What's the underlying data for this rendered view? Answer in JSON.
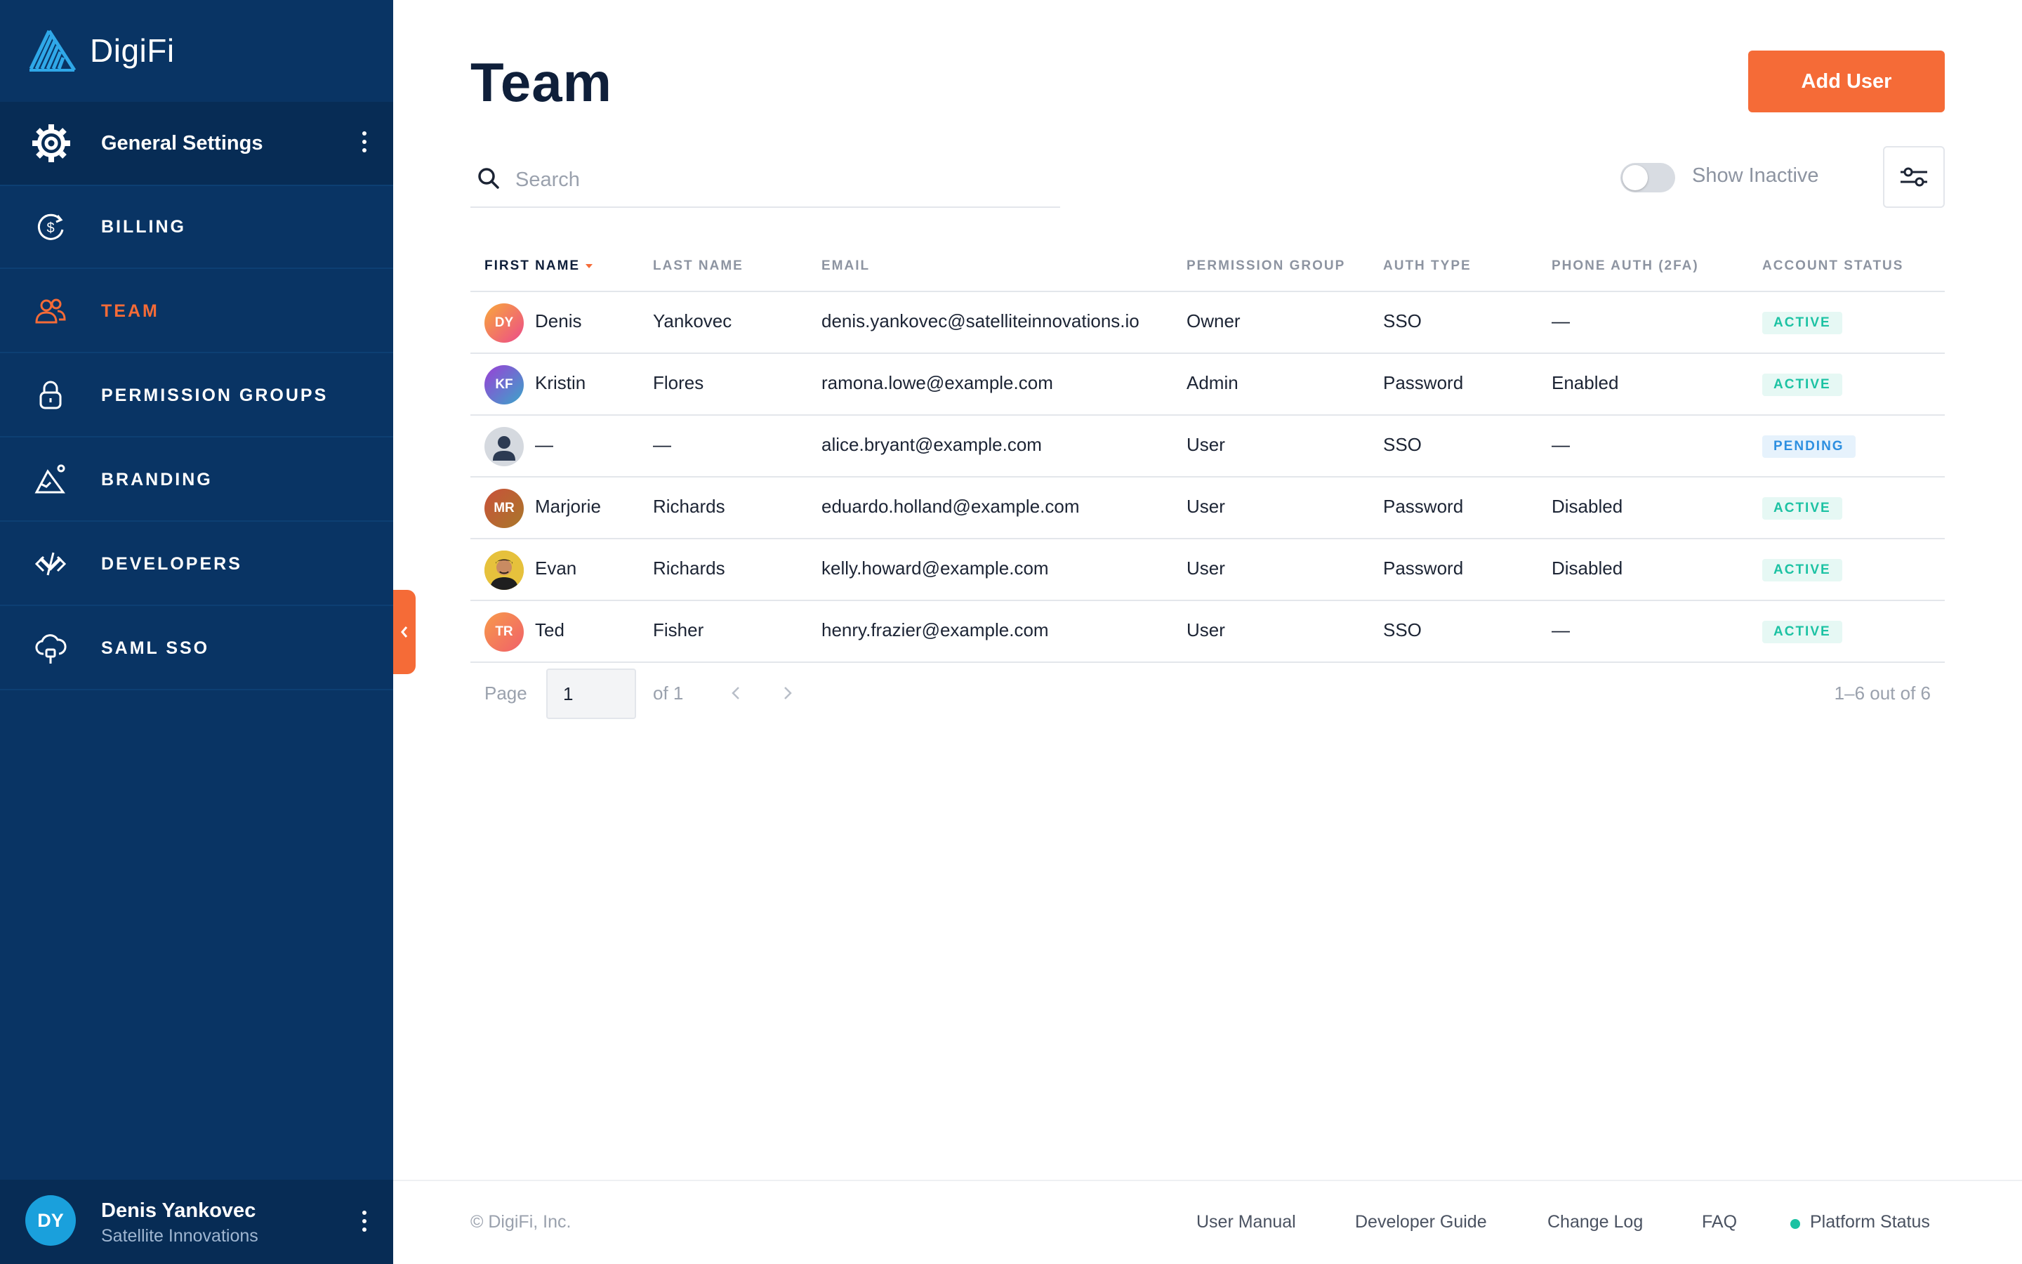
{
  "brand": {
    "name": "DigiFi"
  },
  "sidebar": {
    "settings_label": "General Settings",
    "items": [
      {
        "label": "BILLING",
        "icon": "billing-icon"
      },
      {
        "label": "TEAM",
        "icon": "team-icon"
      },
      {
        "label": "PERMISSION GROUPS",
        "icon": "lock-icon"
      },
      {
        "label": "BRANDING",
        "icon": "branding-icon"
      },
      {
        "label": "DEVELOPERS",
        "icon": "code-icon"
      },
      {
        "label": "SAML SSO",
        "icon": "cloud-lock-icon"
      }
    ],
    "active_item": "TEAM",
    "user": {
      "initials": "DY",
      "name": "Denis Yankovec",
      "org": "Satellite Innovations"
    }
  },
  "page": {
    "title": "Team",
    "add_button": "Add User",
    "search_placeholder": "Search",
    "show_inactive_label": "Show Inactive",
    "show_inactive_on": false
  },
  "table": {
    "columns": [
      "FIRST NAME",
      "LAST NAME",
      "EMAIL",
      "PERMISSION GROUP",
      "AUTH TYPE",
      "PHONE AUTH (2FA)",
      "ACCOUNT STATUS"
    ],
    "sorted_by": "FIRST NAME",
    "rows": [
      {
        "initials": "DY",
        "first": "Denis",
        "last": "Yankovec",
        "email": "denis.yankovec@satelliteinnovations.io",
        "group": "Owner",
        "auth": "SSO",
        "phone": "—",
        "status": "ACTIVE"
      },
      {
        "initials": "KF",
        "first": "Kristin",
        "last": "Flores",
        "email": "ramona.lowe@example.com",
        "group": "Admin",
        "auth": "Password",
        "phone": "Enabled",
        "status": "ACTIVE"
      },
      {
        "initials": "",
        "first": "—",
        "last": "—",
        "email": "alice.bryant@example.com",
        "group": "User",
        "auth": "SSO",
        "phone": "—",
        "status": "PENDING"
      },
      {
        "initials": "MR",
        "first": "Marjorie",
        "last": "Richards",
        "email": "eduardo.holland@example.com",
        "group": "User",
        "auth": "Password",
        "phone": "Disabled",
        "status": "ACTIVE"
      },
      {
        "initials": "",
        "first": "Evan",
        "last": "Richards",
        "email": "kelly.howard@example.com",
        "group": "User",
        "auth": "Password",
        "phone": "Disabled",
        "status": "ACTIVE"
      },
      {
        "initials": "TR",
        "first": "Ted",
        "last": "Fisher",
        "email": "henry.frazier@example.com",
        "group": "User",
        "auth": "SSO",
        "phone": "—",
        "status": "ACTIVE"
      }
    ]
  },
  "pagination": {
    "page_label": "Page",
    "page": "1",
    "of_label": "of 1",
    "summary": "1–6 out of 6"
  },
  "footer": {
    "copyright": "© DigiFi, Inc.",
    "links": [
      "User Manual",
      "Developer Guide",
      "Change Log",
      "FAQ",
      "Platform Status"
    ]
  },
  "colors": {
    "sidebar": "#093464",
    "accent": "#f56b37",
    "active_status": "#1cc2a3",
    "pending_status": "#2d8fe0"
  }
}
